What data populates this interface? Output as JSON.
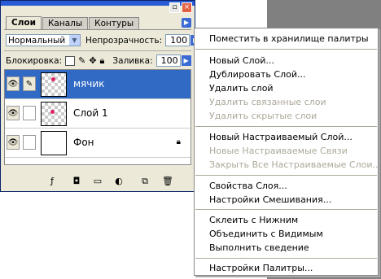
{
  "tabs": [
    "Слои",
    "Каналы",
    "Контуры"
  ],
  "blend_mode": "Нормальный",
  "opacity_label": "Непрозрачность:",
  "opacity_value": "100",
  "lock_label": "Блокировка:",
  "fill_label": "Заливка:",
  "fill_value": "100",
  "layers": [
    {
      "name": "мячик",
      "selected": true
    },
    {
      "name": "Слой 1",
      "selected": false
    },
    {
      "name": "Фон",
      "selected": false,
      "locked": true
    }
  ],
  "menu": {
    "items": [
      {
        "label": "Поместить в хранилище палитры",
        "enabled": true
      },
      {
        "label": "Новый Слой...",
        "enabled": true
      },
      {
        "label": "Дублировать Слой...",
        "enabled": true
      },
      {
        "label": "Удалить слой",
        "enabled": true
      },
      {
        "label": "Удалить связанные слои",
        "enabled": false
      },
      {
        "label": "Удалить скрытые слои",
        "enabled": false
      },
      {
        "label": "Новый Настраиваемый Слой...",
        "enabled": true
      },
      {
        "label": "Новые Настраиваемые Связи",
        "enabled": false
      },
      {
        "label": "Закрыть Все Настраиваемые Слои...",
        "enabled": false
      },
      {
        "label": "Свойства Слоя...",
        "enabled": true
      },
      {
        "label": "Настройки Смешивания...",
        "enabled": true
      },
      {
        "label": "Склеить с Нижним",
        "enabled": true
      },
      {
        "label": "Объединить с Видимым",
        "enabled": true
      },
      {
        "label": "Выполнить сведение",
        "enabled": true
      },
      {
        "label": "Настройки Палитры...",
        "enabled": true
      }
    ]
  }
}
